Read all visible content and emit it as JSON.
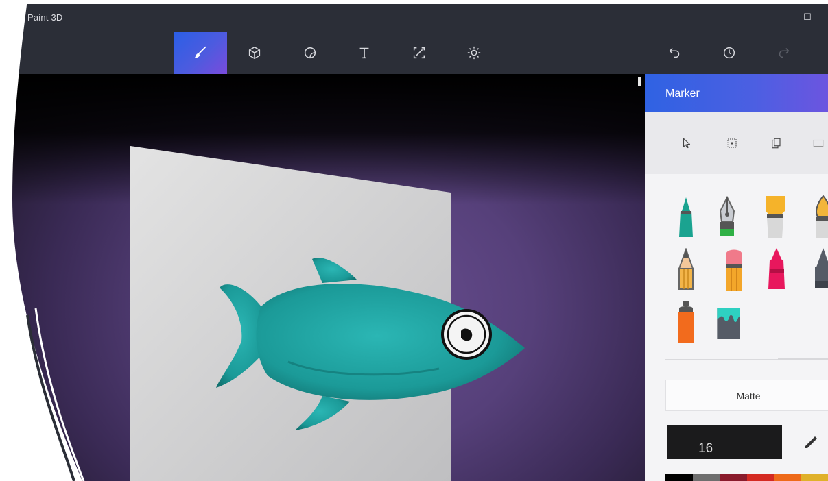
{
  "window": {
    "title": "Paint 3D",
    "minimize_glyph": "–",
    "maximize_glyph": "☐"
  },
  "toolbar": {
    "tools": [
      {
        "name": "brushes",
        "icon": "brush-icon",
        "active": true
      },
      {
        "name": "3d-shapes",
        "icon": "cube-icon",
        "active": false
      },
      {
        "name": "stickers",
        "icon": "sticker-icon",
        "active": false
      },
      {
        "name": "text",
        "icon": "text-icon",
        "active": false
      },
      {
        "name": "canvas",
        "icon": "canvas-resize-icon",
        "active": false
      },
      {
        "name": "effects",
        "icon": "sun-icon",
        "active": false
      }
    ],
    "actions": [
      {
        "name": "undo",
        "icon": "undo-icon",
        "enabled": true
      },
      {
        "name": "history",
        "icon": "history-icon",
        "enabled": true
      },
      {
        "name": "redo",
        "icon": "redo-icon",
        "enabled": false
      }
    ]
  },
  "panel": {
    "title": "Marker",
    "select_tools": [
      "cursor-icon",
      "select-region-icon",
      "paste-icon",
      "crop-icon"
    ],
    "brushes": [
      {
        "name": "marker",
        "icon": "marker-icon",
        "color": "#1aa390"
      },
      {
        "name": "calligraphy-pen",
        "icon": "pen-nib-icon",
        "color": "#2fb045"
      },
      {
        "name": "oil-brush",
        "icon": "oil-brush-icon",
        "color": "#f5b32a"
      },
      {
        "name": "watercolor",
        "icon": "watercolor-icon",
        "color": "#f2b53a"
      },
      {
        "name": "pencil",
        "icon": "pencil-icon",
        "color": "#f3b54a"
      },
      {
        "name": "eraser",
        "icon": "eraser-icon",
        "color": "#f07a8a"
      },
      {
        "name": "crayon",
        "icon": "crayon-icon",
        "color": "#e8175d"
      },
      {
        "name": "pixel-pen",
        "icon": "pixel-pen-icon",
        "color": "#555b66"
      },
      {
        "name": "spray-can",
        "icon": "spray-can-icon",
        "color": "#f26b1d"
      },
      {
        "name": "fill",
        "icon": "fill-bucket-icon",
        "color": "#2ed0c1"
      }
    ],
    "finish": {
      "label": "Matte"
    },
    "thickness": {
      "value": "16"
    },
    "palette": [
      "#000000",
      "#6e6e6e",
      "#8a1b2c",
      "#d42a22",
      "#ee6a1a",
      "#e0b12a"
    ]
  },
  "colors": {
    "accent": "#3a5ee4",
    "fish": "#1fa7a4",
    "background": "#56407a"
  }
}
